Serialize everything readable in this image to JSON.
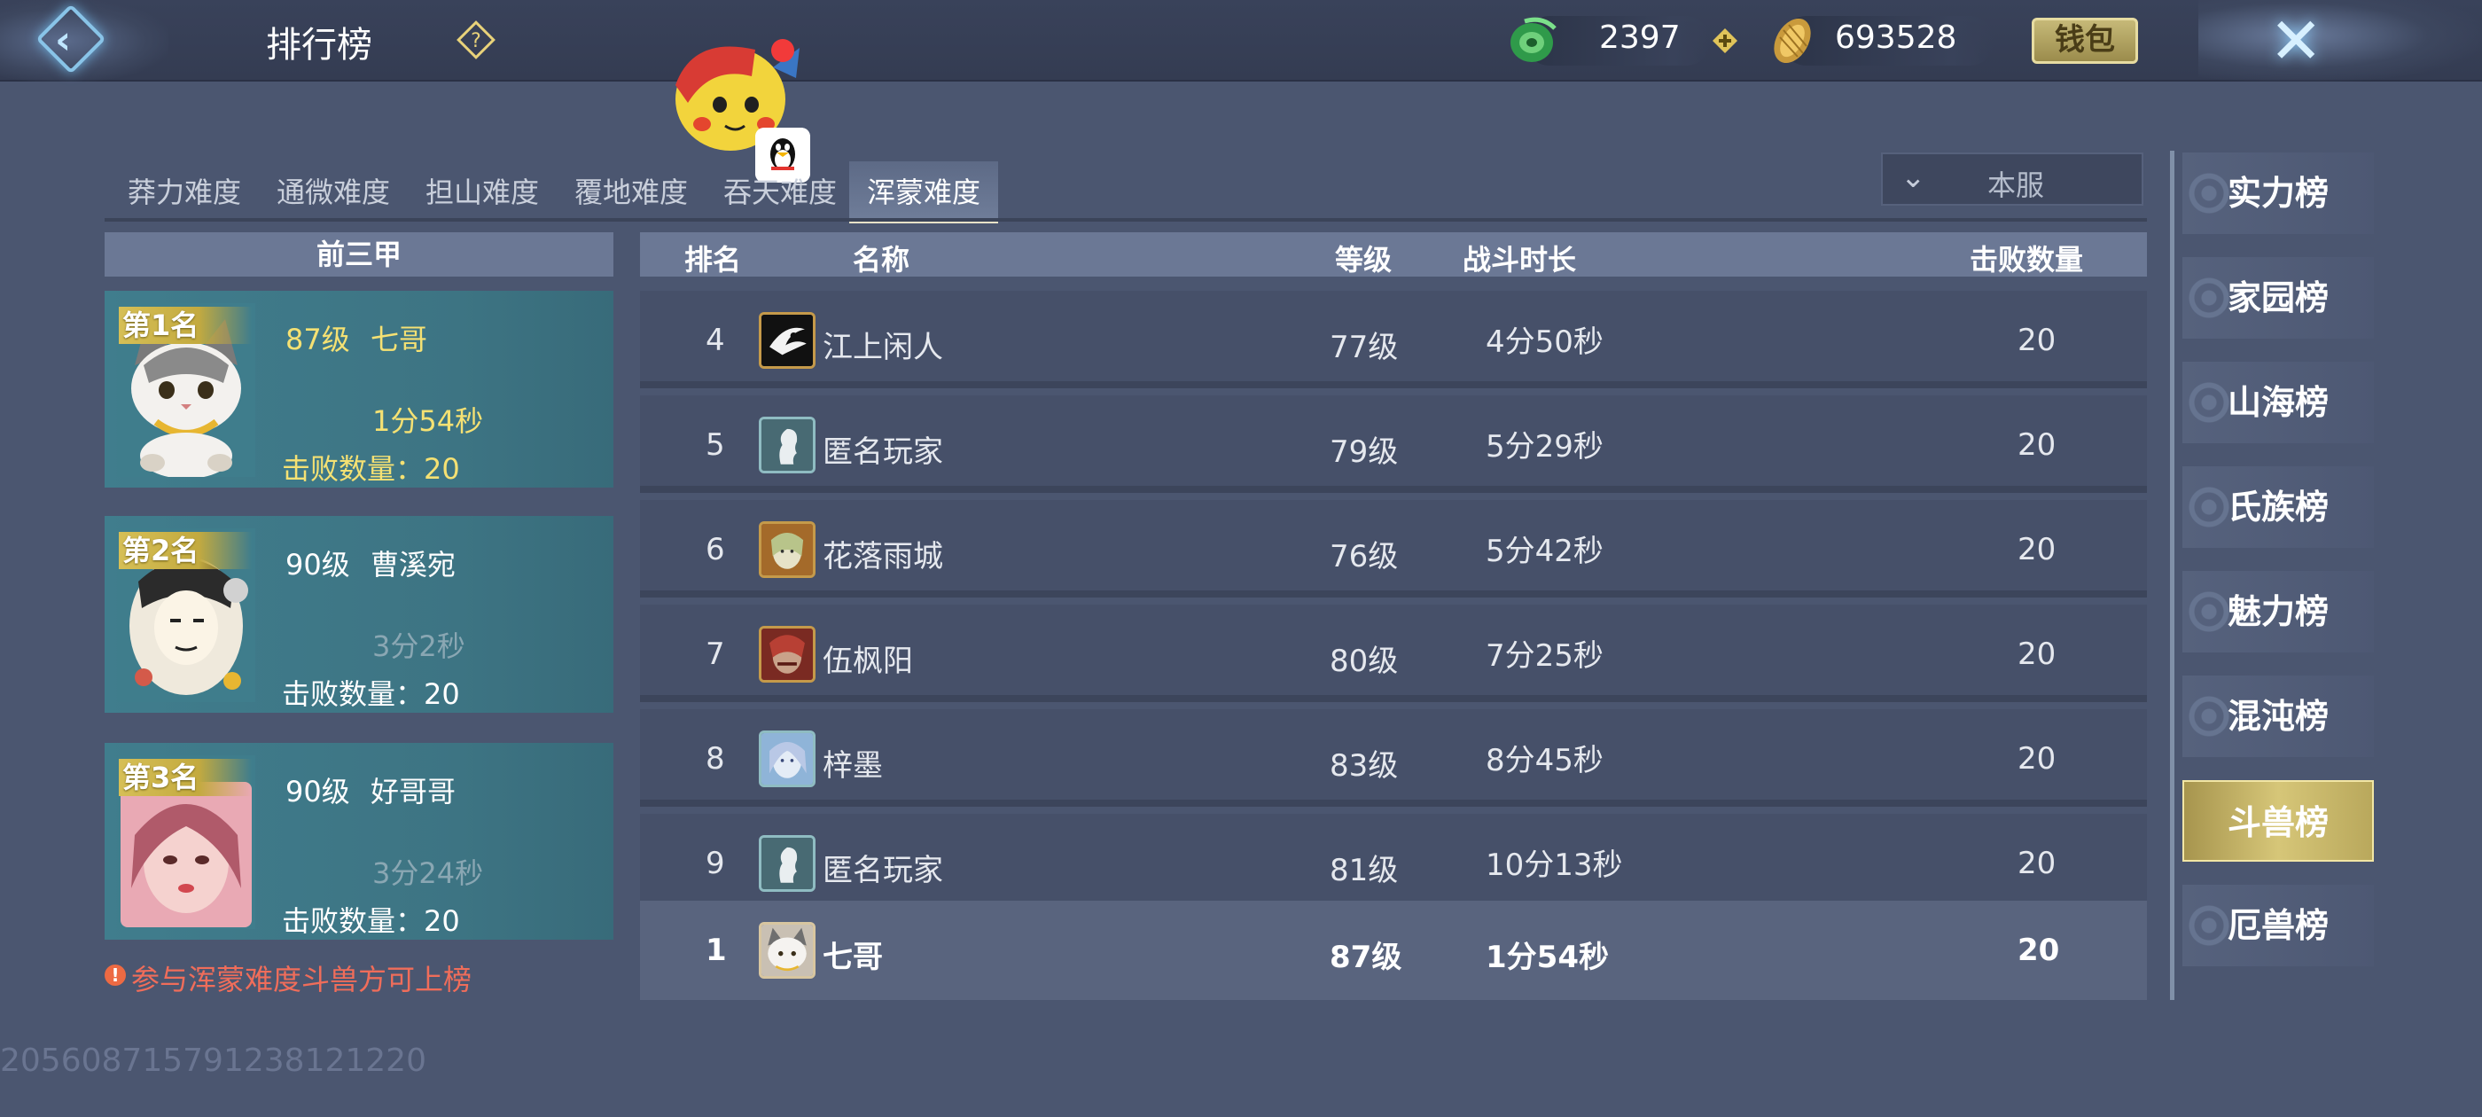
{
  "header": {
    "title": "排行榜",
    "currency_jade": "2397",
    "currency_gold": "693528",
    "wallet_label": "钱包"
  },
  "difficulty_tabs": [
    {
      "label": "莽力难度"
    },
    {
      "label": "通微难度"
    },
    {
      "label": "担山难度"
    },
    {
      "label": "覆地难度"
    },
    {
      "label": "吞天难度"
    },
    {
      "label": "浑蒙难度",
      "active": true
    }
  ],
  "server_select": {
    "value": "本服"
  },
  "top3": {
    "header": "前三甲",
    "cards": [
      {
        "rank_label": "第1名",
        "level": "87级",
        "name": "七哥",
        "time": "1分54秒",
        "kills": "击败数量：20"
      },
      {
        "rank_label": "第2名",
        "level": "90级",
        "name": "曹溪宛",
        "time": "3分2秒",
        "kills": "击败数量：20"
      },
      {
        "rank_label": "第3名",
        "level": "90级",
        "name": "好哥哥",
        "time": "3分24秒",
        "kills": "击败数量：20"
      }
    ],
    "notice": "参与浑蒙难度斗兽方可上榜"
  },
  "table": {
    "headers": {
      "rank": "排名",
      "name": "名称",
      "level": "等级",
      "duration": "战斗时长",
      "kills": "击败数量"
    },
    "rows": [
      {
        "rank": "4",
        "name": "江上闲人",
        "level": "77级",
        "duration": "4分50秒",
        "kills": "20",
        "avatar": "ink-crane-avatar"
      },
      {
        "rank": "5",
        "name": "匿名玩家",
        "level": "79级",
        "duration": "5分29秒",
        "kills": "20",
        "avatar": "anonymous-avatar"
      },
      {
        "rank": "6",
        "name": "花落雨城",
        "level": "76级",
        "duration": "5分42秒",
        "kills": "20",
        "avatar": "elf-avatar"
      },
      {
        "rank": "7",
        "name": "伍枫阳",
        "level": "80级",
        "duration": "7分25秒",
        "kills": "20",
        "avatar": "warrior-avatar"
      },
      {
        "rank": "8",
        "name": "梓墨",
        "level": "83级",
        "duration": "8分45秒",
        "kills": "20",
        "avatar": "ice-avatar"
      },
      {
        "rank": "9",
        "name": "匿名玩家",
        "level": "81级",
        "duration": "10分13秒",
        "kills": "20",
        "avatar": "anonymous-avatar"
      }
    ],
    "my_row": {
      "rank": "1",
      "name": "七哥",
      "level": "87级",
      "duration": "1分54秒",
      "kills": "20",
      "avatar": "cat-avatar"
    }
  },
  "side_tabs": [
    {
      "label": "实力榜"
    },
    {
      "label": "家园榜"
    },
    {
      "label": "山海榜"
    },
    {
      "label": "氏族榜"
    },
    {
      "label": "魅力榜"
    },
    {
      "label": "混沌榜"
    },
    {
      "label": "斗兽榜",
      "active": true
    },
    {
      "label": "厄兽榜"
    }
  ],
  "uid": "2056087157912381212​20",
  "colors": {
    "background": "#4b5670",
    "top_card": "#3d7483",
    "gold_text": "#f5e173",
    "warning": "#f06d5a",
    "active_side_tab": "#d6c678"
  }
}
